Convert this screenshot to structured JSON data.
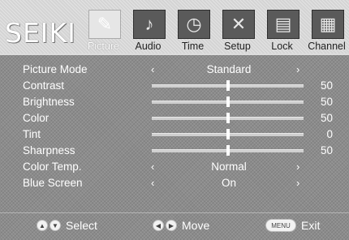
{
  "brand": "SEIKI",
  "tabs": [
    {
      "label": "Picture",
      "icon": "picture-icon"
    },
    {
      "label": "Audio",
      "icon": "audio-icon"
    },
    {
      "label": "Time",
      "icon": "time-icon"
    },
    {
      "label": "Setup",
      "icon": "setup-icon"
    },
    {
      "label": "Lock",
      "icon": "lock-icon"
    },
    {
      "label": "Channel",
      "icon": "channel-icon"
    }
  ],
  "active_tab": "Picture",
  "settings": [
    {
      "label": "Picture Mode",
      "type": "option",
      "value": "Standard"
    },
    {
      "label": "Contrast",
      "type": "slider",
      "value": "50",
      "level": 0.5
    },
    {
      "label": "Brightness",
      "type": "slider",
      "value": "50",
      "level": 0.5
    },
    {
      "label": "Color",
      "type": "slider",
      "value": "50",
      "level": 0.5
    },
    {
      "label": "Tint",
      "type": "slider",
      "value": "0",
      "level": 0.5
    },
    {
      "label": "Sharpness",
      "type": "slider",
      "value": "50",
      "level": 0.5
    },
    {
      "label": "Color Temp.",
      "type": "option",
      "value": "Normal"
    },
    {
      "label": "Blue Screen",
      "type": "option",
      "value": "On"
    }
  ],
  "footer": {
    "select": {
      "label": "Select",
      "buttons": [
        "▲",
        "▼"
      ]
    },
    "move": {
      "label": "Move",
      "buttons": [
        "◀",
        "▶"
      ]
    },
    "exit": {
      "label": "Exit",
      "button": "MENU"
    }
  },
  "colors": {
    "menu_bg": "#8c8c8c",
    "header_bg": "#d4d4d4",
    "text": "#ffffff",
    "active_icon": "#e6e6e6",
    "inactive_icon": "#5a5a5a"
  }
}
